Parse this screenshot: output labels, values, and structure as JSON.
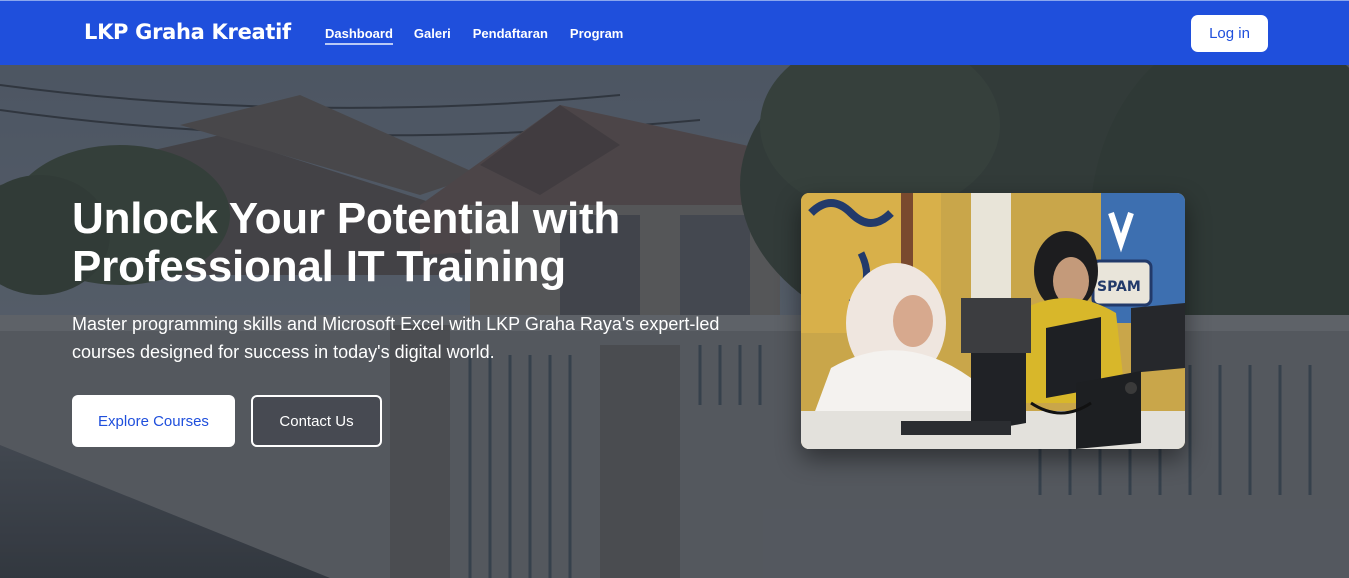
{
  "navbar": {
    "brand": "LKP Graha Kreatif",
    "links": [
      {
        "label": "Dashboard",
        "active": true
      },
      {
        "label": "Galeri",
        "active": false
      },
      {
        "label": "Pendaftaran",
        "active": false
      },
      {
        "label": "Program",
        "active": false
      }
    ],
    "login_label": "Log in"
  },
  "hero": {
    "title": "Unlock Your Potential with Professional IT Training",
    "subtitle": "Master programming skills and Microsoft Excel with LKP Graha Raya's expert-led courses designed for success in today's digital world.",
    "explore_label": "Explore Courses",
    "contact_label": "Contact Us",
    "photo_sign_text": "SPAM"
  },
  "colors": {
    "primary": "#1f4fdc",
    "white": "#ffffff",
    "overlay": "#2a303a"
  }
}
